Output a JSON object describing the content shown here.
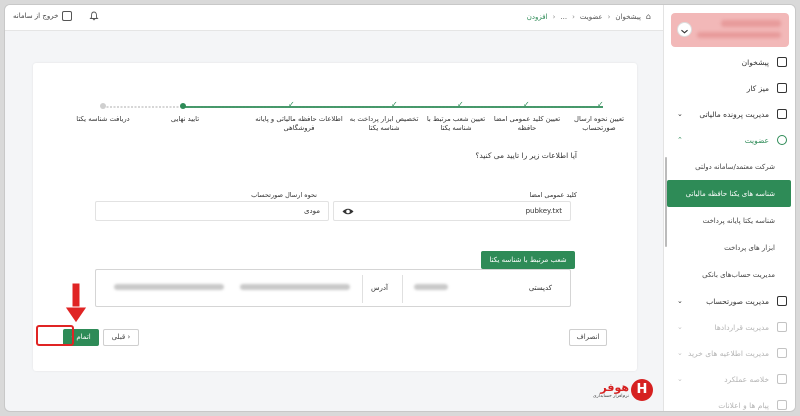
{
  "topbar": {
    "logout_label": "خروج از سامانه",
    "breadcrumbs": [
      "پیشخوان",
      "عضویت",
      "...",
      "افزودن"
    ]
  },
  "sidebar": {
    "items": [
      {
        "label": "پیشخوان",
        "icon": "home-icon"
      },
      {
        "label": "میز کار",
        "icon": "desk-icon"
      },
      {
        "label": "مدیریت پرونده مالیاتی",
        "icon": "file-icon"
      },
      {
        "label": "عضویت",
        "icon": "membership-icon"
      }
    ],
    "sub_items": [
      {
        "label": "شرکت معتمد/سامانه دولتی"
      },
      {
        "label": "شناسه های یکتا حافظه مالیاتی"
      },
      {
        "label": "شناسه یکتا پایانه پرداخت"
      },
      {
        "label": "ابزار های پرداخت"
      },
      {
        "label": "مدیریت حساب‌های بانکی"
      }
    ],
    "lower_items": [
      {
        "label": "مدیریت صورتحساب",
        "icon": "invoice-icon"
      },
      {
        "label": "مدیریت قراردادها",
        "icon": "contract-icon"
      },
      {
        "label": "مدیریت اطلاعیه های خرید",
        "icon": "purchase-icon"
      },
      {
        "label": "خلاصه عملکرد",
        "icon": "summary-icon"
      },
      {
        "label": "پیام ها و اعلانات",
        "icon": "message-icon"
      }
    ]
  },
  "stepper": {
    "steps": [
      "تعیین نحوه ارسال صورتحساب",
      "تعیین کلید عمومی امضا حافظه",
      "تعیین شعب مرتبط با شناسه یکتا",
      "تخصیص ابزار پرداخت به شناسه یکتا",
      "اطلاعات حافظه مالیاتی و پایانه فروشگاهی",
      "تایید نهایی",
      "دریافت شناسه یکتا"
    ],
    "completed": 5,
    "current": 6
  },
  "form": {
    "question": "آیا اطلاعات زیر را تایید می کنید؟",
    "public_key_label": "کلید عمومی امضا",
    "public_key_value": "pubkey.txt",
    "send_method_label": "نحوه ارسال صورتحساب",
    "send_method_value": "مودی"
  },
  "branch": {
    "button_label": "شعب مرتبط با شناسه یکتا",
    "name": "کدپستی",
    "address_label": "آدرس"
  },
  "buttons": {
    "finish": "اتمام",
    "previous": "قبلی",
    "cancel": "انصراف"
  },
  "logo": {
    "name": "هوفر",
    "tagline": "نرم‌افزار حسابداری",
    "mark": "H"
  },
  "colors": {
    "accent": "#2e8b57",
    "highlight": "#e02424"
  }
}
